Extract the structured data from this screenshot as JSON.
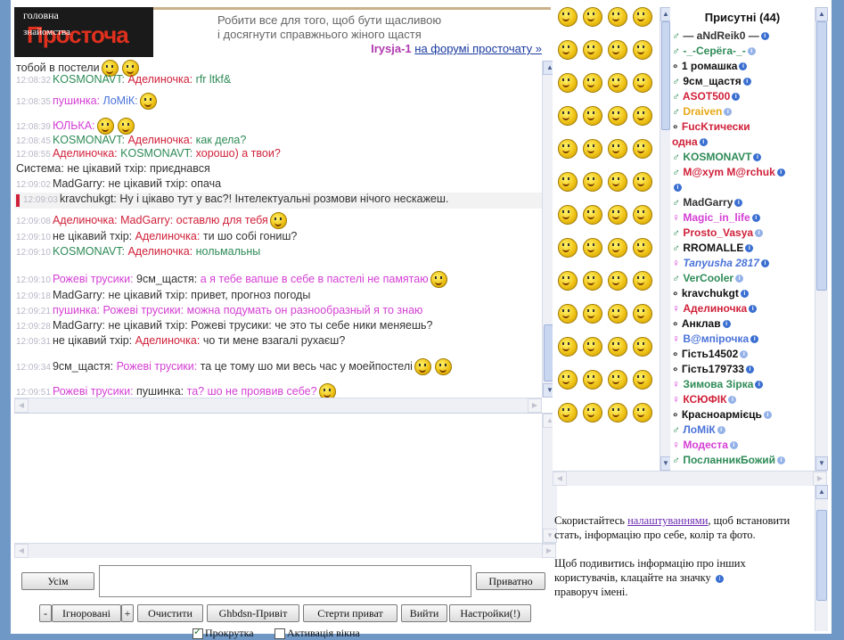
{
  "header": {
    "logo_line1": "головна",
    "logo_line2": "знайомства",
    "logo_big": "Просточа",
    "quote_line1": "Робити все для того, щоб бути щасливою",
    "quote_line2": "і досягнути справжнього жіного щастя",
    "quote_author": "Irysja-1",
    "quote_link": "на форумі просточату »"
  },
  "chat": {
    "lines": [
      {
        "ts": "",
        "nick": "тобой в постели",
        "to": "",
        "text": "",
        "smile": "2"
      },
      {
        "ts": "12:08:32",
        "nick": "KOSMONAVT:",
        "to": "Аделиночка:",
        "text": "rfr ltkf&"
      },
      {
        "ts": "12:08:35",
        "nick": "пушинка:",
        "to": "ЛоМіК:",
        "text": ""
      },
      {
        "ts": "12:08:39",
        "nick": "ЮЛЬКА:",
        "to": "",
        "text": ""
      },
      {
        "ts": "12:08:45",
        "nick": "KOSMONAVT:",
        "to": "Аделиночка:",
        "text": "как дела?"
      },
      {
        "ts": "12:08:55",
        "nick": "Аделиночка:",
        "to": "KOSMONAVT:",
        "text": "хорошо) а твои?"
      },
      {
        "ts": "",
        "nick": "Система:",
        "to": "не цікавий тхір:",
        "text": "приєднався"
      },
      {
        "ts": "12:09:02",
        "nick": "MadGarry:",
        "to": "не цікавий тхір:",
        "text": "опача"
      },
      {
        "ts": "12:09:03",
        "nick": "kravchukgt:",
        "to": "",
        "text": "Ну і цікаво тут у вас?! Інтелектуальні розмови нічого нескажеш."
      },
      {
        "ts": "12:09:08",
        "nick": "Аделиночка:",
        "to": "MadGarry:",
        "text": "оставлю для тебя"
      },
      {
        "ts": "12:09:10",
        "nick": "не цікавий тхір:",
        "to": "Аделиночка:",
        "text": "ти шо собі гониш?"
      },
      {
        "ts": "12:09:10",
        "nick": "KOSMONAVT:",
        "to": "Аделиночка:",
        "text": "нольмальны"
      },
      {
        "ts": "12:09:10",
        "nick": "Рожеві трусики:",
        "to": "9см_щастя:",
        "text": "а я тебе вапше в себе в пастелі не памятаю"
      },
      {
        "ts": "12:09:18",
        "nick": "MadGarry:",
        "to": "не цікавий тхір:",
        "text": "привет, прогноз погоды"
      },
      {
        "ts": "12:09:21",
        "nick": "пушинка:",
        "to": "Рожеві трусики:",
        "text": "можна подумать он разнообразный я то знаю"
      },
      {
        "ts": "12:09:28",
        "nick": "MadGarry:",
        "to": "не цікавий тхір:",
        "text": "Рожеві трусики: че это ты себе ники меняешь?"
      },
      {
        "ts": "12:09:31",
        "nick": "не цікавий тхір:",
        "to": "Аделиночка:",
        "text": "чо ти мене взагалі рухаєш?"
      },
      {
        "ts": "12:09:34",
        "nick": "9см_щастя:",
        "to": "Рожеві трусики:",
        "text": "та це тому шо ми весь час у моейпостелі"
      },
      {
        "ts": "12:09:51",
        "nick": "Рожеві трусики:",
        "to": "пушинка:",
        "text": "та? шо не проявив себе?"
      }
    ]
  },
  "users": {
    "header": "Присутні (44)",
    "list": [
      {
        "sex": "♂",
        "name": "— aNdReik0 —",
        "color": "#333333"
      },
      {
        "sex": "♂",
        "name": "-_-Серёга-_-",
        "color": "#2e8b57"
      },
      {
        "sex": "∘",
        "name": "1 ромашка",
        "color": "#111111"
      },
      {
        "sex": "♂",
        "name": "9см_щастя",
        "color": "#111111"
      },
      {
        "sex": "♂",
        "name": "ASOT500",
        "color": "#d0213a"
      },
      {
        "sex": "♂",
        "name": "Draiven",
        "color": "#e6a817"
      },
      {
        "sex": "∘",
        "name": "FucKтически",
        "color": "#d0213a"
      },
      {
        "sex": "",
        "name": "одна",
        "color": "#d0213a"
      },
      {
        "sex": "♂",
        "name": "KOSMONAVT",
        "color": "#2e8b57"
      },
      {
        "sex": "♂",
        "name": "M@xym M@rchuk",
        "color": "#d0213a"
      },
      {
        "sex": "",
        "name": "",
        "color": "#3a6fd1"
      },
      {
        "sex": "♂",
        "name": "MadGarry",
        "color": "#333333"
      },
      {
        "sex": "♀",
        "name": "Magic_in_life",
        "color": "#d43fd4"
      },
      {
        "sex": "♂",
        "name": "Prosto_Vasya",
        "color": "#d0213a"
      },
      {
        "sex": "♂",
        "name": "RROMALLE",
        "color": "#111111"
      },
      {
        "sex": "♀",
        "name": "Tanyusha 2817",
        "color": "#4a73d9"
      },
      {
        "sex": "♂",
        "name": "VerCooler",
        "color": "#2e8b57"
      },
      {
        "sex": "∘",
        "name": "kravchukgt",
        "color": "#111111"
      },
      {
        "sex": "♀",
        "name": "Аделиночка",
        "color": "#d0213a"
      },
      {
        "sex": "∘",
        "name": "Анклав",
        "color": "#111111"
      },
      {
        "sex": "♀",
        "name": "В@мпірочка",
        "color": "#4a73d9"
      },
      {
        "sex": "∘",
        "name": "Гість14502",
        "color": "#111111"
      },
      {
        "sex": "∘",
        "name": "Гість179733",
        "color": "#111111"
      },
      {
        "sex": "♀",
        "name": "Зимова Зірка",
        "color": "#2e8b57"
      },
      {
        "sex": "♀",
        "name": "КСЮФІК",
        "color": "#d0213a"
      },
      {
        "sex": "∘",
        "name": "Красноармієць",
        "color": "#111111"
      },
      {
        "sex": "♂",
        "name": "ЛоМіК",
        "color": "#4a73d9"
      },
      {
        "sex": "♀",
        "name": "Модеста",
        "color": "#d43fd4"
      },
      {
        "sex": "♂",
        "name": "ПосланникБожий",
        "color": "#2e8b57"
      }
    ]
  },
  "help": {
    "p1_a": "Скористайтесь",
    "p1_link": "налаштуваннями",
    "p1_b": ", щоб встановити стать, інформацію про себе, колір та фото.",
    "p2": "Щоб подивитись інформацію про інших користувачів, клацайте на значку",
    "p2_end": "праворуч імені."
  },
  "toolbar": {
    "all_button": "Усім",
    "private_button": "Приватно",
    "minus": "-",
    "ignored": "Ігноровані",
    "plus": "+",
    "clear": "Очистити",
    "greeting": "Ghbdsn-Привіт",
    "erase_private": "Стерти приват",
    "exit": "Вийти",
    "settings": "Настройки(!)",
    "scroll_label": "Прокрутка",
    "activate_label": "Активація вікна"
  },
  "colors": {
    "accent": "#6f98c6",
    "male": "#2e8b57",
    "female": "#d43fd4",
    "alert": "#d0213a"
  }
}
